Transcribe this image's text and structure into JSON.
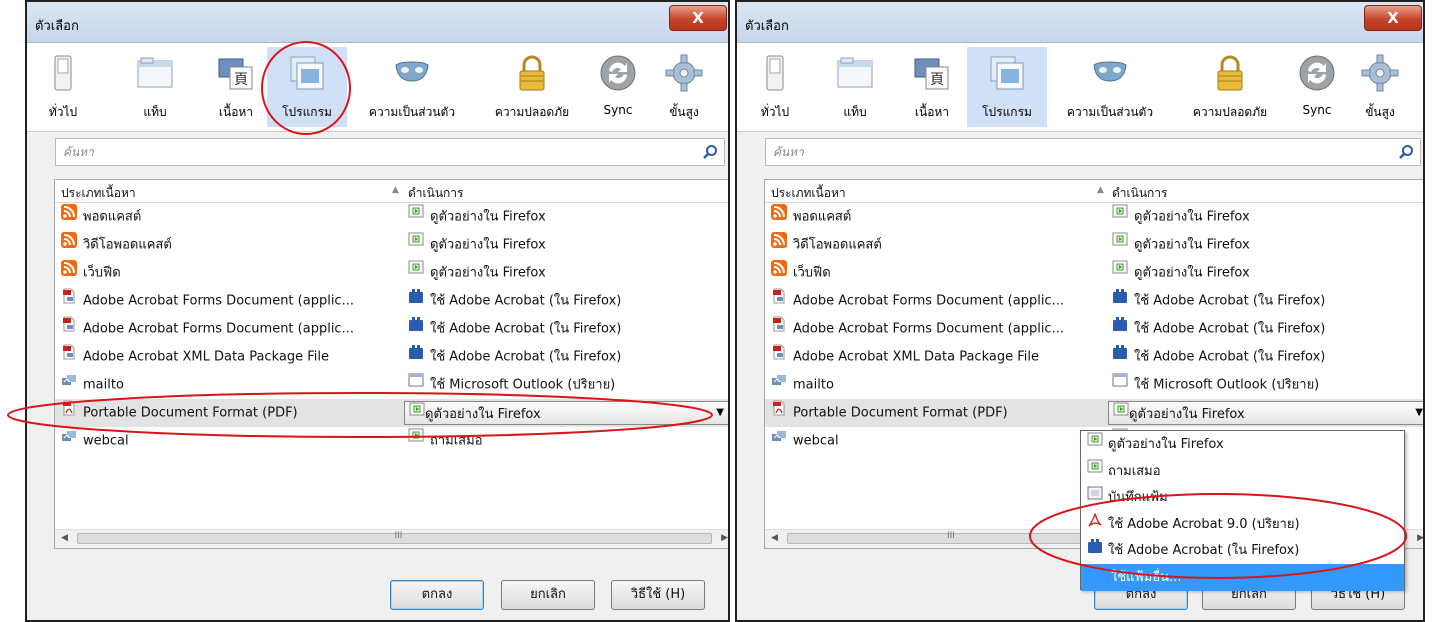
{
  "dialog": {
    "title": "ตัวเลือก",
    "close_label": "X",
    "toolbar": [
      {
        "label": "ทั่วไป",
        "icon": "general-switch-icon"
      },
      {
        "label": "แท็บ",
        "icon": "tabs-window-icon"
      },
      {
        "label": "เนื้อหา",
        "icon": "content-icon"
      },
      {
        "label": "โปรแกรม",
        "icon": "applications-icon",
        "selected": true
      },
      {
        "label": "ความเป็นส่วนตัว",
        "icon": "privacy-mask-icon"
      },
      {
        "label": "ความปลอดภัย",
        "icon": "security-lock-icon"
      },
      {
        "label": "Sync",
        "icon": "sync-icon"
      },
      {
        "label": "ขั้นสูง",
        "icon": "advanced-gear-icon"
      }
    ],
    "search_placeholder": "ค้นหา",
    "columns": {
      "content_type": "ประเภทเนื้อหา",
      "action": "ดำเนินการ"
    },
    "rows": [
      {
        "type": "พอดแคสต์",
        "action": "ดูตัวอย่างใน Firefox",
        "type_icon": "rss-feed-icon",
        "action_icon": "preview-icon"
      },
      {
        "type": "วิดีโอพอดแคสต์",
        "action": "ดูตัวอย่างใน Firefox",
        "type_icon": "rss-feed-icon",
        "action_icon": "preview-icon"
      },
      {
        "type": "เว็บฟีด",
        "action": "ดูตัวอย่างใน Firefox",
        "type_icon": "rss-feed-icon",
        "action_icon": "preview-icon"
      },
      {
        "type": "Adobe Acrobat Forms Document (applic...",
        "action": "ใช้ Adobe Acrobat (ใน Firefox)",
        "type_icon": "acrobat-form-file-icon",
        "action_icon": "plugin-block-icon"
      },
      {
        "type": "Adobe Acrobat Forms Document (applic...",
        "action": "ใช้ Adobe Acrobat (ใน Firefox)",
        "type_icon": "acrobat-form-file-icon",
        "action_icon": "plugin-block-icon"
      },
      {
        "type": "Adobe Acrobat XML Data Package File",
        "action": "ใช้ Adobe Acrobat (ใน Firefox)",
        "type_icon": "acrobat-xml-file-icon",
        "action_icon": "plugin-block-icon"
      },
      {
        "type": "mailto",
        "action": "ใช้ Microsoft Outlook (ปริยาย)",
        "type_icon": "protocol-icon",
        "action_icon": "application-window-icon"
      },
      {
        "type": "Portable Document Format (PDF)",
        "action": "ดูตัวอย่างใน Firefox",
        "type_icon": "pdf-file-icon",
        "action_icon": "preview-icon",
        "selected": true
      },
      {
        "type": "webcal",
        "action": "ถามเสมอ",
        "type_icon": "protocol-icon",
        "action_icon": "preview-icon"
      }
    ],
    "scroll_grip": "III",
    "buttons": {
      "ok": "ตกลง",
      "cancel": "ยกเลิก",
      "help": "วิธีใช้ (H)"
    }
  },
  "dropdown_options": [
    {
      "label": "ดูตัวอย่างใน Firefox",
      "icon": "preview-icon"
    },
    {
      "label": "ถามเสมอ",
      "icon": "preview-icon"
    },
    {
      "label": "บันทึกแฟ้ม",
      "icon": "save-file-icon"
    },
    {
      "label": "ใช้ Adobe Acrobat 9.0 (ปริยาย)",
      "icon": "acrobat-logo-icon"
    },
    {
      "label": "ใช้ Adobe Acrobat (ใน Firefox)",
      "icon": "plugin-block-icon"
    },
    {
      "label": "ใช้แฟ้มอื่น...",
      "icon": "",
      "highlighted": true
    }
  ],
  "colors": {
    "annotation": "#d9141b",
    "selection": "#cfe0f7",
    "menu_highlight": "#3399ff",
    "rss": "#f26a10"
  }
}
